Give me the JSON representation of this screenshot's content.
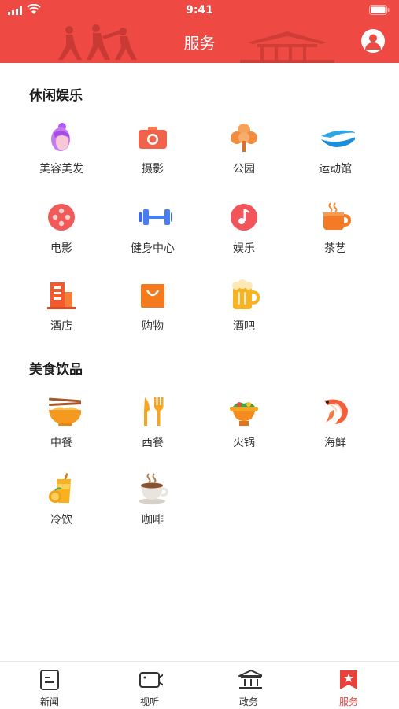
{
  "status_bar": {
    "time": "9:41"
  },
  "header": {
    "title": "服务"
  },
  "colors": {
    "brand": "#ee4a43",
    "active_tab": "#e8403a"
  },
  "sections": [
    {
      "title": "休闲娱乐",
      "items": [
        {
          "label": "美容美发",
          "icon": "beauty-icon"
        },
        {
          "label": "摄影",
          "icon": "camera-icon"
        },
        {
          "label": "公园",
          "icon": "tree-icon"
        },
        {
          "label": "运动馆",
          "icon": "stadium-icon"
        },
        {
          "label": "电影",
          "icon": "film-reel-icon"
        },
        {
          "label": "健身中心",
          "icon": "dumbbell-icon"
        },
        {
          "label": "娱乐",
          "icon": "music-note-icon"
        },
        {
          "label": "茶艺",
          "icon": "tea-cup-icon"
        },
        {
          "label": "酒店",
          "icon": "hotel-icon"
        },
        {
          "label": "购物",
          "icon": "shopping-bag-icon"
        },
        {
          "label": "酒吧",
          "icon": "beer-mug-icon"
        }
      ]
    },
    {
      "title": "美食饮品",
      "items": [
        {
          "label": "中餐",
          "icon": "noodle-bowl-icon"
        },
        {
          "label": "西餐",
          "icon": "fork-knife-icon"
        },
        {
          "label": "火锅",
          "icon": "hotpot-icon"
        },
        {
          "label": "海鲜",
          "icon": "shrimp-icon"
        },
        {
          "label": "冷饮",
          "icon": "juice-icon"
        },
        {
          "label": "咖啡",
          "icon": "coffee-icon"
        }
      ]
    }
  ],
  "tabbar": {
    "tabs": [
      {
        "label": "新闻",
        "icon": "news-icon"
      },
      {
        "label": "视听",
        "icon": "video-camera-icon"
      },
      {
        "label": "政务",
        "icon": "government-icon"
      },
      {
        "label": "服务",
        "icon": "service-bookmark-icon",
        "active": true
      }
    ]
  }
}
